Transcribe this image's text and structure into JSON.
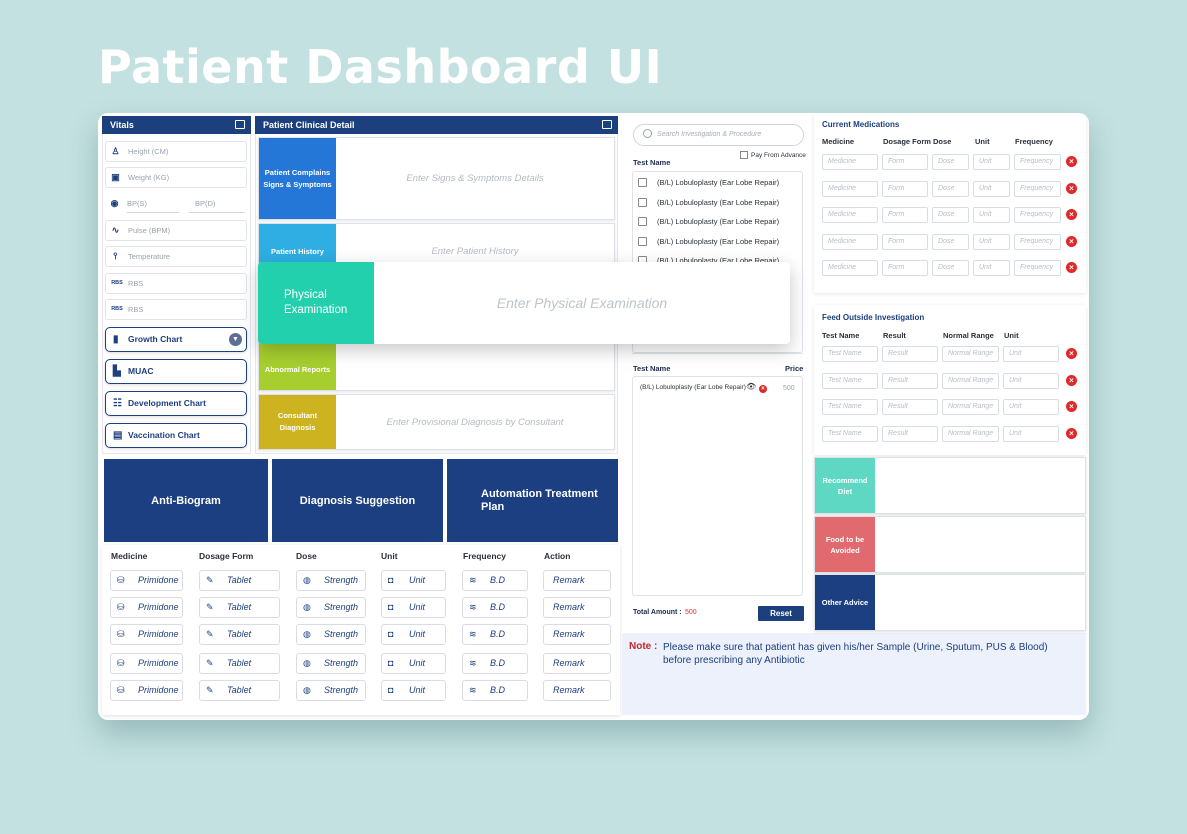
{
  "page_title": "Patient Dashboard UI",
  "vitals": {
    "title": "Vitals",
    "fields": [
      {
        "icon": "height-icon",
        "label": "Height (CM)"
      },
      {
        "icon": "weight-icon",
        "label": "Weight (KG)"
      },
      {
        "icon": "blood-pressure-icon",
        "label": "BP(S)",
        "label2": "BP(D)"
      },
      {
        "icon": "pulse-icon",
        "label": "Pulse (BPM)"
      },
      {
        "icon": "thermometer-icon",
        "label": "Temperature"
      },
      {
        "icon_text": "RBS",
        "label": "RBS"
      },
      {
        "icon_text": "RBS",
        "label": "RBS"
      }
    ],
    "buttons": [
      "Growth Chart",
      "MUAC",
      "Development Chart",
      "Vaccination Chart"
    ]
  },
  "clinical": {
    "title": "Patient Clinical Detail",
    "rows": [
      {
        "label": "Patient Complains Signs & Symptoms",
        "placeholder": "Enter Signs & Symptoms Details",
        "color": "#2477d6"
      },
      {
        "label": "Patient History",
        "placeholder": "Enter Patient History",
        "color": "#2eaee2"
      },
      {
        "label": "Abnormal Reports",
        "placeholder": "",
        "color": "#a6ce2e"
      },
      {
        "label": "Consultant Diagnosis",
        "placeholder": "Enter Provisional Diagnosis by Consultant",
        "color": "#cdb31f"
      }
    ],
    "focused": {
      "label": "Physical Examination",
      "placeholder": "Enter Physical Examination",
      "color": "#23d0ae"
    }
  },
  "actions": [
    "Anti-Biogram",
    "Diagnosis Suggestion",
    "Automation Treatment Plan"
  ],
  "medicine_table": {
    "headers": [
      "Medicine",
      "Dosage Form",
      "Dose",
      "Unit",
      "Frequency",
      "Action"
    ],
    "rows": [
      [
        "Primidone",
        "Tablet",
        "Strength",
        "Unit",
        "B.D",
        "Remark"
      ],
      [
        "Primidone",
        "Tablet",
        "Strength",
        "Unit",
        "B.D",
        "Remark"
      ],
      [
        "Primidone",
        "Tablet",
        "Strength",
        "Unit",
        "B.D",
        "Remark"
      ],
      [
        "Primidone",
        "Tablet",
        "Strength",
        "Unit",
        "B.D",
        "Remark"
      ],
      [
        "Primidone",
        "Tablet",
        "Strength",
        "Unit",
        "B.D",
        "Remark"
      ]
    ]
  },
  "investigation": {
    "search_placeholder": "Search Investigation & Procedure",
    "pay_from_advance": "Pay From Advance",
    "test_name_header": "Test Name",
    "tests": [
      "(B/L) Lobuloplasty (Ear Lobe Repair)",
      "(B/L) Lobuloplasty (Ear Lobe Repair)",
      "(B/L) Lobuloplasty (Ear Lobe Repair)",
      "(B/L) Lobuloplasty (Ear Lobe Repair)",
      "(B/L) Lobuloplasty (Ear Lobe Repair)"
    ],
    "selected_header": "Test Name",
    "price_header": "Price",
    "selected": [
      {
        "name": "(B/L) Lobuloplasty (Ear Lobe Repair)",
        "price": "500"
      }
    ],
    "total_label": "Total Amount :",
    "total_value": "500",
    "reset": "Reset"
  },
  "note": {
    "label": "Note :",
    "text": "Please make sure that patient has given his/her Sample (Urine, Sputum, PUS & Blood) before prescribing any Antibiotic"
  },
  "current_medications": {
    "title": "Current Medications",
    "headers": [
      "Medicine",
      "Dosage Form",
      "Dose",
      "Unit",
      "Frequency"
    ],
    "placeholders": [
      "Medicine",
      "Form",
      "Dose",
      "Unit",
      "Frequency"
    ],
    "row_count": 5
  },
  "outside_investigation": {
    "title": "Feed Outside Investigation",
    "headers": [
      "Test Name",
      "Result",
      "Normal Range",
      "Unit"
    ],
    "placeholders": [
      "Test Name",
      "Result",
      "Normal Range",
      "Unit"
    ],
    "row_count": 4
  },
  "diet": [
    {
      "label": "Recommend Diet",
      "color": "#5fd8c3"
    },
    {
      "label": "Food to be Avoided",
      "color": "#e06a6e"
    },
    {
      "label": "Other Advice",
      "color": "#1b3f80"
    }
  ],
  "colors": {
    "primary": "#1c3f7e",
    "delete": "#e02a2a",
    "note_bg": "#edf1fc",
    "note_label": "#c8232c"
  }
}
